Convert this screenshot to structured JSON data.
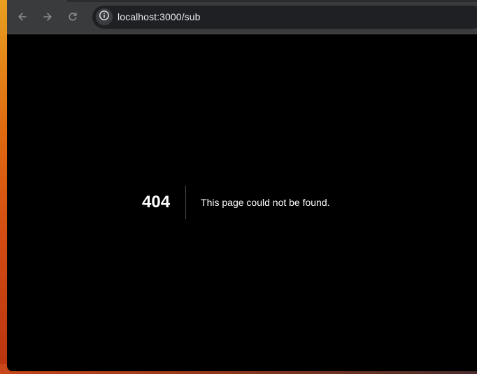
{
  "browser": {
    "url": "localhost:3000/sub",
    "back_icon": "arrow-left-icon",
    "forward_icon": "arrow-right-icon",
    "reload_icon": "reload-icon",
    "site_info_icon": "info-icon"
  },
  "page": {
    "error_code": "404",
    "error_message": "This page could not be found."
  },
  "colors": {
    "page_background": "#000000",
    "toolbar_background": "#3a3b3d",
    "omnibox_background": "#1f2023",
    "text": "#ffffff"
  }
}
